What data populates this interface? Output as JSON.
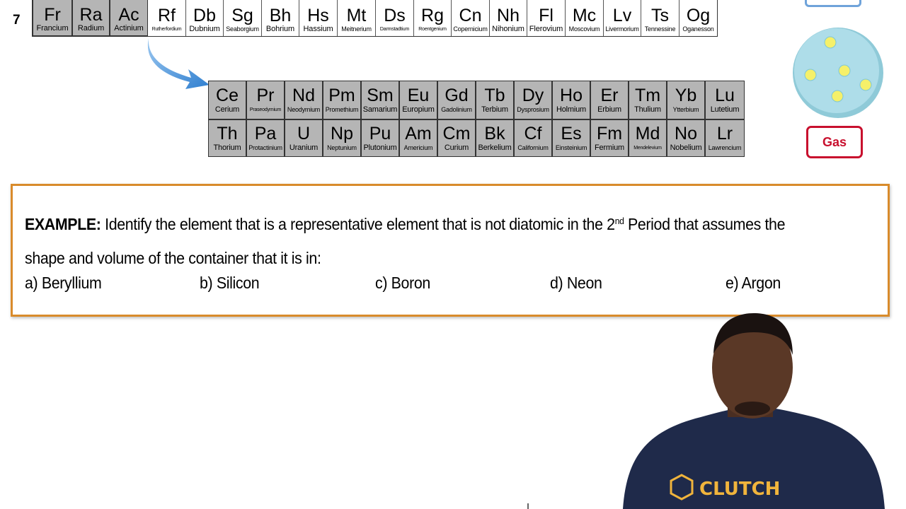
{
  "period_row": {
    "label": "7",
    "elements": [
      {
        "symbol": "Fr",
        "name": "Francium",
        "highlight": true,
        "size": "normal"
      },
      {
        "symbol": "Ra",
        "name": "Radium",
        "highlight": true,
        "size": "normal"
      },
      {
        "symbol": "Ac",
        "name": "Actinium",
        "highlight": true,
        "size": "normal"
      },
      {
        "symbol": "Rf",
        "name": "Rutherfordium",
        "highlight": false,
        "size": "tiny"
      },
      {
        "symbol": "Db",
        "name": "Dubnium",
        "highlight": false,
        "size": "normal"
      },
      {
        "symbol": "Sg",
        "name": "Seaborgium",
        "highlight": false,
        "size": "small"
      },
      {
        "symbol": "Bh",
        "name": "Bohrium",
        "highlight": false,
        "size": "normal"
      },
      {
        "symbol": "Hs",
        "name": "Hassium",
        "highlight": false,
        "size": "normal"
      },
      {
        "symbol": "Mt",
        "name": "Meitnerium",
        "highlight": false,
        "size": "small"
      },
      {
        "symbol": "Ds",
        "name": "Darmstadtium",
        "highlight": false,
        "size": "tiny"
      },
      {
        "symbol": "Rg",
        "name": "Roentgenium",
        "highlight": false,
        "size": "tiny"
      },
      {
        "symbol": "Cn",
        "name": "Copernicium",
        "highlight": false,
        "size": "small"
      },
      {
        "symbol": "Nh",
        "name": "Nihonium",
        "highlight": false,
        "size": "normal"
      },
      {
        "symbol": "Fl",
        "name": "Flerovium",
        "highlight": false,
        "size": "normal"
      },
      {
        "symbol": "Mc",
        "name": "Moscovium",
        "highlight": false,
        "size": "small"
      },
      {
        "symbol": "Lv",
        "name": "Livermorium",
        "highlight": false,
        "size": "small"
      },
      {
        "symbol": "Ts",
        "name": "Tennessine",
        "highlight": false,
        "size": "small"
      },
      {
        "symbol": "Og",
        "name": "Oganesson",
        "highlight": false,
        "size": "small"
      }
    ]
  },
  "f_block": {
    "lanthanides": [
      {
        "symbol": "Ce",
        "name": "Cerium",
        "size": "normal"
      },
      {
        "symbol": "Pr",
        "name": "Praseodymium",
        "size": "tiny"
      },
      {
        "symbol": "Nd",
        "name": "Neodymium",
        "size": "small"
      },
      {
        "symbol": "Pm",
        "name": "Promethium",
        "size": "small"
      },
      {
        "symbol": "Sm",
        "name": "Samarium",
        "size": "normal"
      },
      {
        "symbol": "Eu",
        "name": "Europium",
        "size": "normal"
      },
      {
        "symbol": "Gd",
        "name": "Gadolinium",
        "size": "small"
      },
      {
        "symbol": "Tb",
        "name": "Terbium",
        "size": "normal"
      },
      {
        "symbol": "Dy",
        "name": "Dysprosium",
        "size": "small"
      },
      {
        "symbol": "Ho",
        "name": "Holmium",
        "size": "normal"
      },
      {
        "symbol": "Er",
        "name": "Erbium",
        "size": "normal"
      },
      {
        "symbol": "Tm",
        "name": "Thulium",
        "size": "normal"
      },
      {
        "symbol": "Yb",
        "name": "Ytterbium",
        "size": "small"
      },
      {
        "symbol": "Lu",
        "name": "Lutetium",
        "size": "normal"
      }
    ],
    "actinides": [
      {
        "symbol": "Th",
        "name": "Thorium",
        "size": "normal"
      },
      {
        "symbol": "Pa",
        "name": "Protactinium",
        "size": "small"
      },
      {
        "symbol": "U",
        "name": "Uranium",
        "size": "normal"
      },
      {
        "symbol": "Np",
        "name": "Neptunium",
        "size": "small"
      },
      {
        "symbol": "Pu",
        "name": "Plutonium",
        "size": "normal"
      },
      {
        "symbol": "Am",
        "name": "Americium",
        "size": "small"
      },
      {
        "symbol": "Cm",
        "name": "Curium",
        "size": "normal"
      },
      {
        "symbol": "Bk",
        "name": "Berkelium",
        "size": "normal"
      },
      {
        "symbol": "Cf",
        "name": "Californium",
        "size": "small"
      },
      {
        "symbol": "Es",
        "name": "Einsteinium",
        "size": "small"
      },
      {
        "symbol": "Fm",
        "name": "Fermium",
        "size": "normal"
      },
      {
        "symbol": "Md",
        "name": "Mendelevium",
        "size": "tiny"
      },
      {
        "symbol": "No",
        "name": "Nobelium",
        "size": "normal"
      },
      {
        "symbol": "Lr",
        "name": "Lawrencium",
        "size": "small"
      }
    ]
  },
  "state_panel": {
    "gas_label": "Gas",
    "colors": {
      "gas": "#c8102e",
      "box_top": "#6fa3da",
      "sphere": "#a8dbe8",
      "molecule": "#f5f06a"
    }
  },
  "example": {
    "lead": "EXAMPLE:",
    "question_part1": " Identify the element that is a representative element that is not diatomic in the 2",
    "superscript": "nd",
    "question_part2": " Period that assumes the shape and volume of the container that it is in:",
    "choices": [
      {
        "label": "a) Beryllium"
      },
      {
        "label": "b) Silicon"
      },
      {
        "label": "c) Boron"
      },
      {
        "label": "d) Neon"
      },
      {
        "label": "e) Argon"
      }
    ],
    "border_color": "#d98b2b"
  },
  "presenter": {
    "shirt_text": "CLUTCH",
    "shirt_color": "#1f2a4a",
    "logo_color": "#f0b43c"
  }
}
